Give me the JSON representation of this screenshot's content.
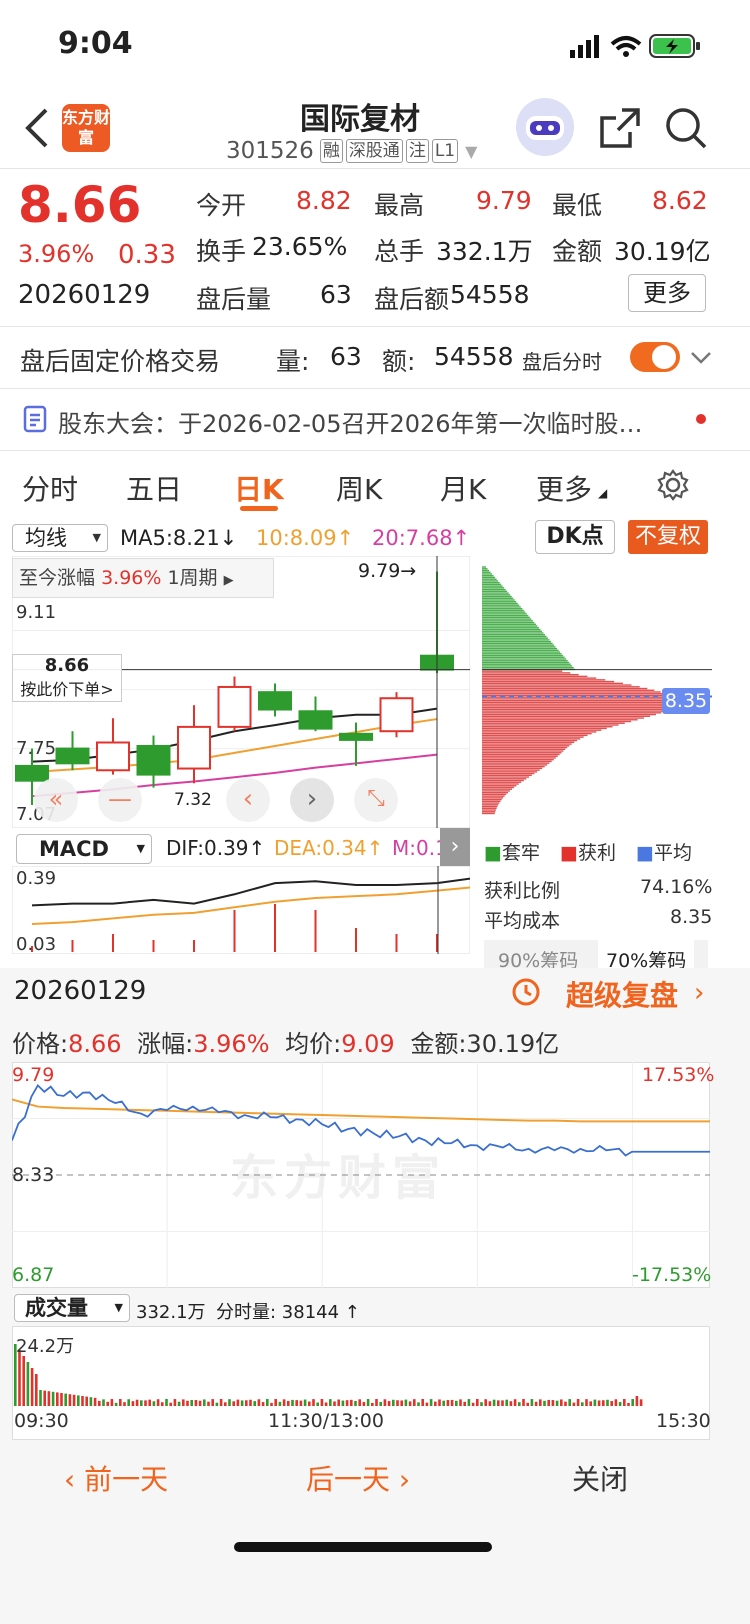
{
  "status_bar": {
    "time": "9:04"
  },
  "header": {
    "logo_text": "东方财富",
    "title": "国际复材",
    "code": "301526",
    "chips": [
      "融",
      "深股通",
      "注",
      "L1"
    ]
  },
  "quote": {
    "price": "8.66",
    "change_pct": "3.96%",
    "change": "0.33",
    "date": "20260129",
    "open_label": "今开",
    "open": "8.82",
    "high_label": "最高",
    "high": "9.79",
    "low_label": "最低",
    "low": "8.62",
    "turnover_label": "换手",
    "turnover": "23.65%",
    "volume_label": "总手",
    "volume": "332.1万",
    "amount_label": "金额",
    "amount": "30.19亿",
    "after_vol_label": "盘后量",
    "after_vol": "63",
    "after_amt_label": "盘后额",
    "after_amt": "54558",
    "more_label": "更多"
  },
  "after_hours": {
    "title": "盘后固定价格交易",
    "vol_label": "量:",
    "vol": "63",
    "amt_label": "额:",
    "amt": "54558",
    "toggle_label": "盘后分时",
    "toggle_on": true
  },
  "notice": {
    "text": "股东大会：于2026-02-05召开2026年第一次临时股…"
  },
  "tabs": {
    "items": [
      "分时",
      "五日",
      "日K",
      "周K",
      "月K",
      "更多"
    ],
    "active": "日K"
  },
  "kline": {
    "indicator_select": "均线",
    "ma5": "MA5:8.21↓",
    "ma10": "10:8.09↑",
    "ma20": "20:7.68↑",
    "dk_label": "DK点",
    "fq_label": "不复权",
    "range_label": "至今涨幅",
    "range_pct": "3.96%",
    "range_period": "1周期",
    "high_marker": "9.79→",
    "low_marker": "7.32",
    "price_label": "8.66",
    "order_label": "按此价下单>",
    "y_labels": [
      "9.11",
      "7.75",
      "7.07"
    ],
    "cost_price": "8.35",
    "colors": {
      "up": "#e2322b",
      "down": "#2e9b2e",
      "ma5": "#222222",
      "ma10": "#f0a030",
      "ma20": "#d63fa0"
    }
  },
  "chart_data": [
    {
      "type": "candlestick",
      "title": "",
      "ohlc": [
        [
          7.55,
          7.75,
          7.1,
          7.38
        ],
        [
          7.75,
          7.95,
          7.5,
          7.58
        ],
        [
          7.5,
          8.1,
          7.45,
          7.82
        ],
        [
          7.78,
          7.9,
          7.3,
          7.45
        ],
        [
          7.52,
          8.25,
          7.35,
          8.0
        ],
        [
          8.0,
          8.58,
          7.95,
          8.46
        ],
        [
          8.4,
          8.5,
          8.12,
          8.2
        ],
        [
          8.18,
          8.35,
          7.95,
          7.98
        ],
        [
          7.92,
          8.05,
          7.55,
          7.85
        ],
        [
          7.95,
          8.4,
          7.88,
          8.33
        ],
        [
          8.82,
          9.79,
          8.62,
          8.66
        ]
      ],
      "ma5": [
        7.6,
        7.62,
        7.68,
        7.74,
        7.84,
        7.95,
        8.02,
        8.1,
        8.14,
        8.14,
        8.21
      ],
      "ma10": [
        7.48,
        7.51,
        7.54,
        7.58,
        7.62,
        7.7,
        7.78,
        7.86,
        7.94,
        8.02,
        8.09
      ],
      "ma20": [
        7.2,
        7.24,
        7.28,
        7.33,
        7.37,
        7.42,
        7.47,
        7.53,
        7.58,
        7.63,
        7.68
      ]
    },
    {
      "type": "line",
      "title": "MACD",
      "dif": [
        0.24,
        0.25,
        0.25,
        0.27,
        0.25,
        0.3,
        0.36,
        0.37,
        0.35,
        0.35,
        0.36,
        0.39
      ],
      "dea": [
        0.14,
        0.15,
        0.17,
        0.19,
        0.2,
        0.23,
        0.26,
        0.28,
        0.29,
        0.3,
        0.32,
        0.34
      ],
      "macd_bars": [
        0.01,
        0.02,
        0.03,
        0.02,
        0.02,
        0.07,
        0.08,
        0.07,
        0.04,
        0.03,
        0.03,
        0.05
      ]
    },
    {
      "type": "line",
      "title": "",
      "x_ticks": [
        "09:30",
        "11:30/13:00",
        "15:30"
      ],
      "y_left": [
        "9.79",
        "8.33",
        "6.87"
      ],
      "y_right": [
        "17.53%",
        "-17.53%"
      ],
      "price": [
        8.82,
        9.6,
        9.45,
        9.5,
        9.35,
        9.2,
        9.25,
        9.3,
        9.22,
        9.18,
        9.15,
        9.12,
        9.05,
        8.98,
        8.92,
        8.88,
        8.82,
        8.78,
        8.75,
        8.72,
        8.7,
        8.68,
        8.7,
        8.68,
        8.66
      ],
      "avg": [
        9.4,
        9.3,
        9.28,
        9.27,
        9.26,
        9.25,
        9.24,
        9.23,
        9.22,
        9.21,
        9.2,
        9.19,
        9.18,
        9.17,
        9.16,
        9.15,
        9.14,
        9.13,
        9.12,
        9.11,
        9.1,
        9.1,
        9.09,
        9.09,
        9.09
      ]
    }
  ],
  "macd": {
    "select": "MACD",
    "dif": "DIF:0.39↑",
    "dea": "DEA:0.34↑",
    "m": "M:0.1…",
    "y_labels": [
      "0.39",
      "0.03"
    ]
  },
  "chips_panel": {
    "legend": [
      "套牢",
      "获利",
      "平均"
    ],
    "profit_ratio_label": "获利比例",
    "profit_ratio": "74.16%",
    "avg_cost_label": "平均成本",
    "avg_cost": "8.35",
    "tab_90": "90%筹码",
    "tab_70": "70%筹码"
  },
  "replay": {
    "date": "20260129",
    "title": "超级复盘",
    "price_label": "价格:",
    "price": "8.66",
    "chg_label": "涨幅:",
    "chg": "3.96%",
    "avg_label": "均价:",
    "avg": "9.09",
    "amt_label": "金额:",
    "amt": "30.19亿",
    "volume_select": "成交量",
    "volume_total": "332.1万",
    "tick_vol": "分时量: 38144 ↑",
    "vol_max": "24.2万",
    "watermark": "东方财富"
  },
  "bottom_nav": {
    "prev": "前一天",
    "next": "后一天",
    "close": "关闭"
  }
}
